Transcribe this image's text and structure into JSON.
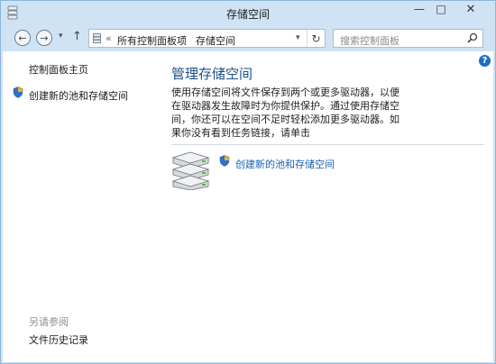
{
  "window": {
    "title": "存储空间"
  },
  "controls": {
    "minimize": "—",
    "maximize": "□",
    "close": "✕"
  },
  "nav": {
    "back": "←",
    "forward": "→",
    "recent": "▾",
    "up": "↑",
    "address_chevron": "«",
    "breadcrumb": [
      "所有控制面板项",
      "存储空间"
    ],
    "separator": "›",
    "dropdown": "▾",
    "refresh": "↻"
  },
  "search": {
    "placeholder": "搜索控制面板"
  },
  "help": {
    "label": "?"
  },
  "sidebar": {
    "home_link": "控制面板主页",
    "create_link": "创建新的池和存储空间",
    "see_also_heading": "另请参阅",
    "file_history_link": "文件历史记录"
  },
  "main": {
    "title": "管理存储空间",
    "description": "使用存储空间将文件保存到两个或更多驱动器，以便在驱动器发生故障时为你提供保护。通过使用存储空间，你还可以在空间不足时轻松添加更多驱动器。如果你没有看到任务链接，请单击",
    "create_link": "创建新的池和存储空间"
  },
  "colors": {
    "frame": "#cfe3f4",
    "title_blue": "#1a4f8c",
    "link_blue": "#1a5fb4",
    "shield_blue": "#2f6fcf",
    "shield_gold": "#e8b72a"
  }
}
